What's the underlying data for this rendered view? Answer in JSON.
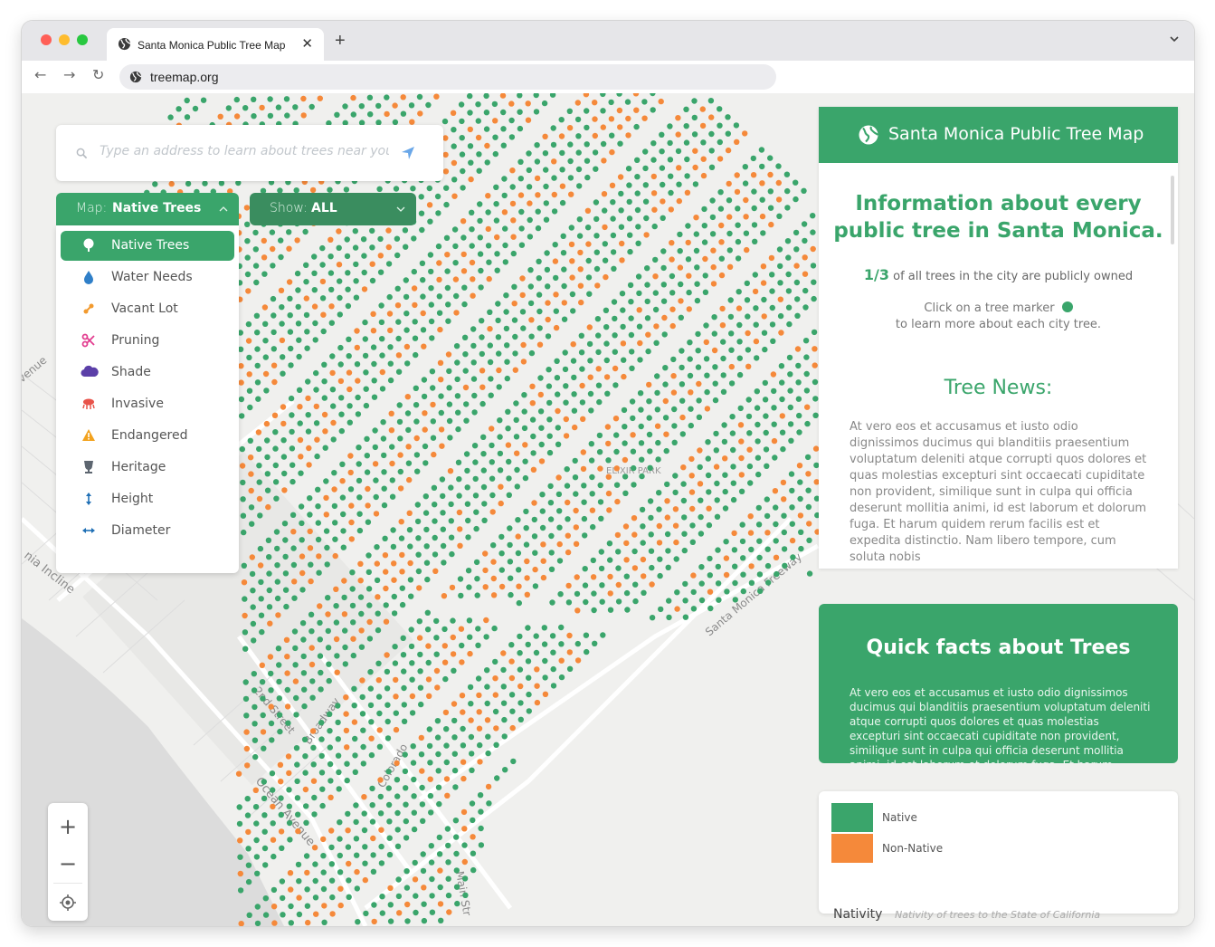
{
  "browser": {
    "tab_title": "Santa Monica Public Tree Map",
    "tab_close": "✕",
    "new_tab": "+",
    "url": "treemap.org",
    "traffic_colors": [
      "#ff5f57",
      "#febc2e",
      "#28c840"
    ]
  },
  "search": {
    "placeholder": "Type an address to learn about trees near you"
  },
  "map_dropdown": {
    "label": "Map:",
    "value": "Native Trees",
    "items": [
      {
        "label": "Native Trees",
        "icon": "tree-icon",
        "active": true
      },
      {
        "label": "Water Needs",
        "icon": "water-drop-icon"
      },
      {
        "label": "Vacant Lot",
        "icon": "vacant-lot-icon"
      },
      {
        "label": "Pruning",
        "icon": "scissors-icon"
      },
      {
        "label": "Shade",
        "icon": "cloud-icon"
      },
      {
        "label": "Invasive",
        "icon": "invasive-icon"
      },
      {
        "label": "Endangered",
        "icon": "warning-icon"
      },
      {
        "label": "Heritage",
        "icon": "trophy-icon"
      },
      {
        "label": "Height",
        "icon": "vertical-arrows-icon"
      },
      {
        "label": "Diameter",
        "icon": "horizontal-arrows-icon"
      }
    ]
  },
  "show_dropdown": {
    "label": "Show:",
    "value": "ALL"
  },
  "zoom": {
    "in": "+",
    "out": "−"
  },
  "map_labels": {
    "labels": [
      "Ocean Avenue",
      "2nd Street",
      "Broadway",
      "Main Str",
      "Santa Monica Freeway",
      "Colorado",
      "nia Incline",
      "venue",
      "ELIXIR PARK"
    ]
  },
  "info_panel": {
    "title": "Santa Monica Public Tree Map",
    "headline_1": "Information about every",
    "headline_2": "public tree in Santa Monica.",
    "fraction": "1/3",
    "fraction_text": "of all trees in the city are publicly owned",
    "click_line_1": "Click on a tree marker",
    "click_line_2": "to learn more about each city tree.",
    "news_title": "Tree News:",
    "news_body": "At vero eos et accusamus et iusto odio dignissimos ducimus qui blanditiis praesentium voluptatum deleniti atque corrupti quos dolores et quas molestias excepturi sint occaecati cupiditate non provident, similique sunt in culpa qui officia deserunt mollitia animi, id est laborum et dolorum fuga. Et harum quidem rerum facilis est et expedita distinctio. Nam libero tempore, cum soluta nobis"
  },
  "quick_facts": {
    "title": "Quick facts about Trees",
    "body": "At vero eos et accusamus et iusto odio dignissimos ducimus qui blanditiis praesentium voluptatum deleniti atque corrupti quos dolores et quas molestias excepturi sint occaecati cupiditate non provident, similique sunt in culpa qui officia deserunt mollitia animi, id est laborum et dolorum fuga. Et harum quidem rerum facilis est et"
  },
  "legend": {
    "items": [
      {
        "label": "Native",
        "color": "#3aa56b"
      },
      {
        "label": "Non-Native",
        "color": "#f5893a"
      }
    ],
    "title": "Nativity",
    "subtitle": "Nativity of trees to the State of California"
  },
  "colors": {
    "accent": "#3aa56b",
    "native": "#3aa56b",
    "non_native": "#f5893a"
  }
}
